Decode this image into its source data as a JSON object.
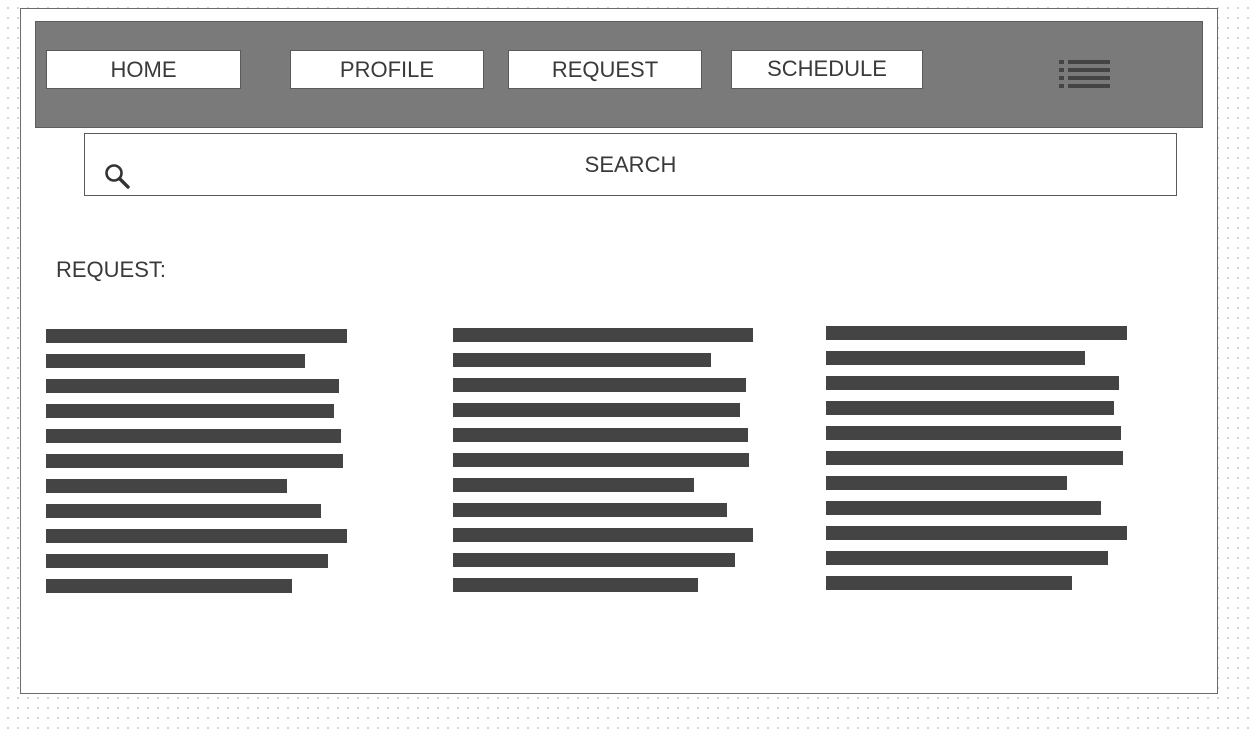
{
  "nav": {
    "items": [
      {
        "label": "HOME"
      },
      {
        "label": "PROFILE"
      },
      {
        "label": "REQUEST"
      },
      {
        "label": "SCHEDULE"
      }
    ],
    "menu_icon": "list-menu-icon"
  },
  "search": {
    "label": "SEARCH",
    "icon": "search-icon"
  },
  "section": {
    "title": "REQUEST:"
  },
  "colors": {
    "navbar_bg": "#7a7a7a",
    "text_bar": "#444444",
    "border": "#5a5a5a"
  }
}
